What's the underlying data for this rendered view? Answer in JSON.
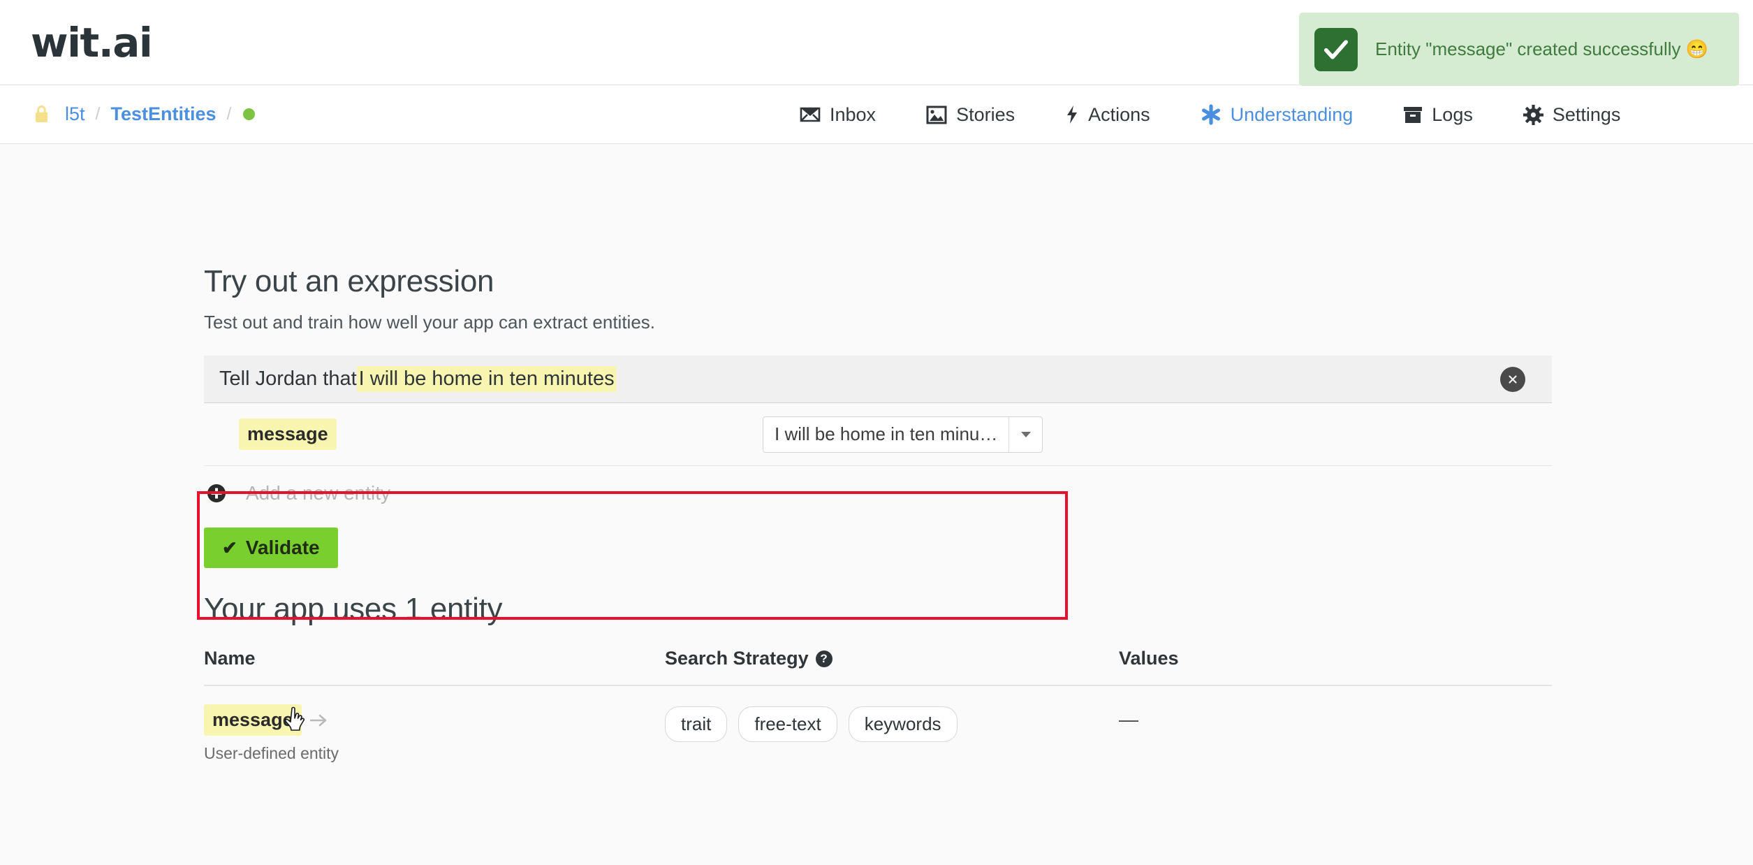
{
  "header": {
    "logo": "wit.ai"
  },
  "toast": {
    "icon": "check-icon",
    "message": "Entity \"message\" created successfully 😁",
    "bg_color": "#d6ecd2",
    "icon_bg_color": "#2e7031",
    "text_color": "#3f7a3f"
  },
  "breadcrumb": {
    "lock_icon": "lock-icon",
    "owner": "l5t",
    "separator": "/",
    "app": "TestEntities",
    "status_dot_color": "#7dc242"
  },
  "nav": {
    "items": [
      {
        "label": "Inbox",
        "icon": "inbox-icon",
        "active": false
      },
      {
        "label": "Stories",
        "icon": "image-icon",
        "active": false
      },
      {
        "label": "Actions",
        "icon": "bolt-icon",
        "active": false
      },
      {
        "label": "Understanding",
        "icon": "asterisk-icon",
        "active": true
      },
      {
        "label": "Logs",
        "icon": "archive-icon",
        "active": false
      },
      {
        "label": "Settings",
        "icon": "gear-icon",
        "active": false
      }
    ],
    "active_color": "#4a8fe0"
  },
  "main": {
    "title": "Try out an expression",
    "subtitle": "Test out and train how well your app can extract entities.",
    "expression": {
      "prefix": "Tell Jordan that ",
      "highlighted": "I will be home in ten minutes",
      "highlight_color": "#f7f5b0",
      "clear_icon": "close-icon"
    },
    "entity_row": {
      "name": "message",
      "value": "I will be home in ten minu…",
      "dropdown_icon": "chevron-down-icon"
    },
    "add_entity": {
      "icon": "plus-circle-icon",
      "placeholder": "Add a new entity"
    },
    "validate_button": {
      "label": "Validate",
      "icon": "check-mark-icon",
      "color": "#79cf2e"
    }
  },
  "entities_section": {
    "title": "Your app uses 1 entity",
    "columns": {
      "name": "Name",
      "strategy": "Search Strategy",
      "strategy_help_icon": "question-mark-icon",
      "values": "Values"
    },
    "rows": [
      {
        "name": "message",
        "arrow_icon": "arrow-right-icon",
        "subtitle": "User-defined entity",
        "strategies": [
          "trait",
          "free-text",
          "keywords"
        ],
        "values": "—"
      }
    ]
  },
  "annotation": {
    "border_color": "#e8112d"
  }
}
